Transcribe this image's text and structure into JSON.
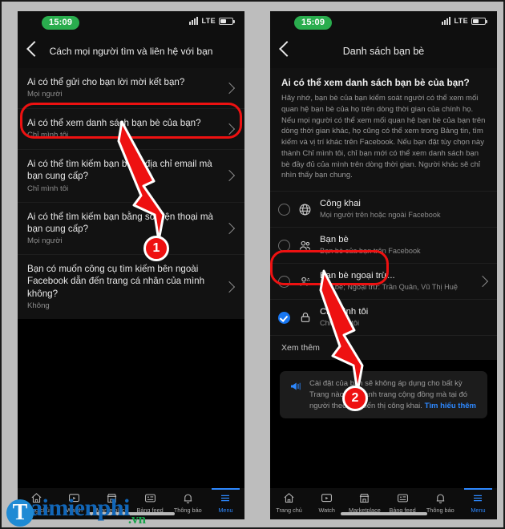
{
  "statusbar": {
    "time": "15:09",
    "network": "LTE"
  },
  "left_panel": {
    "nav_title": "Cách mọi người tìm và liên hệ với bạn",
    "rows": [
      {
        "title": "Ai có thể gửi cho bạn lời mời kết bạn?",
        "value": "Mọi người"
      },
      {
        "title": "Ai có thể xem danh sách bạn bè của bạn?",
        "value": "Chỉ mình tôi"
      },
      {
        "title": "Ai có thể tìm kiếm bạn bằng địa chỉ email mà bạn cung cấp?",
        "value": "Chỉ mình tôi"
      },
      {
        "title": "Ai có thể tìm kiếm bạn bằng số điện thoại mà bạn cung cấp?",
        "value": "Mọi người"
      },
      {
        "title": "Bạn có muốn công cụ tìm kiếm bên ngoài Facebook dẫn đến trang cá nhân của mình không?",
        "value": "Không"
      }
    ]
  },
  "right_panel": {
    "nav_title": "Danh sách bạn bè",
    "description_title": "Ai có thể xem danh sách bạn bè của bạn?",
    "description_body": "Hãy nhớ, bạn bè của bạn kiểm soát người có thể xem mối quan hệ bạn bè của họ trên dòng thời gian của chính họ. Nếu mọi người có thể xem mối quan hệ bạn bè của bạn trên dòng thời gian khác, họ cũng có thể xem trong Bảng tin, tìm kiếm và vị trí khác trên Facebook. Nếu bạn đặt tùy chọn này thành Chỉ mình tôi, chỉ bạn mới có thể xem danh sách bạn bè đầy đủ của mình trên dòng thời gian. Người khác sẽ chỉ nhìn thấy bạn chung.",
    "options": [
      {
        "label": "Công khai",
        "sub": "Mọi người trên hoặc ngoài Facebook",
        "icon": "globe-icon",
        "selected": false,
        "chevron": false
      },
      {
        "label": "Bạn bè",
        "sub": "Bạn bè của bạn trên Facebook",
        "icon": "friends-icon",
        "selected": false,
        "chevron": false
      },
      {
        "label": "Bạn bè ngoại trừ...",
        "sub": "Bạn bè; Ngoại trừ: Trần Quân, Vũ Thị Huệ",
        "icon": "friends-except-icon",
        "selected": false,
        "chevron": true
      },
      {
        "label": "Chỉ mình tôi",
        "sub": "Chỉ mình tôi",
        "icon": "lock-icon",
        "selected": true,
        "chevron": false
      }
    ],
    "see_more": "Xem thêm",
    "notice_text": "Cài đặt của bạn sẽ không áp dụng cho bất kỳ Trang nào trở thành trang cộng đồng mà tại đó người theo dõi hiển thị công khai. ",
    "notice_link": "Tìm hiểu thêm"
  },
  "tabbar": {
    "items": [
      {
        "label": "Trang chủ",
        "icon": "home-icon",
        "active": false
      },
      {
        "label": "Watch",
        "icon": "watch-icon",
        "active": false
      },
      {
        "label": "Marketplace",
        "icon": "marketplace-icon",
        "active": false
      },
      {
        "label": "Bảng feed",
        "icon": "feed-icon",
        "active": false
      },
      {
        "label": "Thông báo",
        "icon": "bell-icon",
        "active": false
      },
      {
        "label": "Menu",
        "icon": "menu-icon",
        "active": true
      }
    ]
  },
  "annotations": {
    "badge_1": "1",
    "badge_2": "2"
  },
  "watermark": {
    "logo_letter": "T",
    "name": "aimienphi",
    "tld": ".vn"
  },
  "colors": {
    "accent_blue": "#2d88ff",
    "annotation_red": "#ee1111",
    "clock_green": "#2aad4e"
  }
}
